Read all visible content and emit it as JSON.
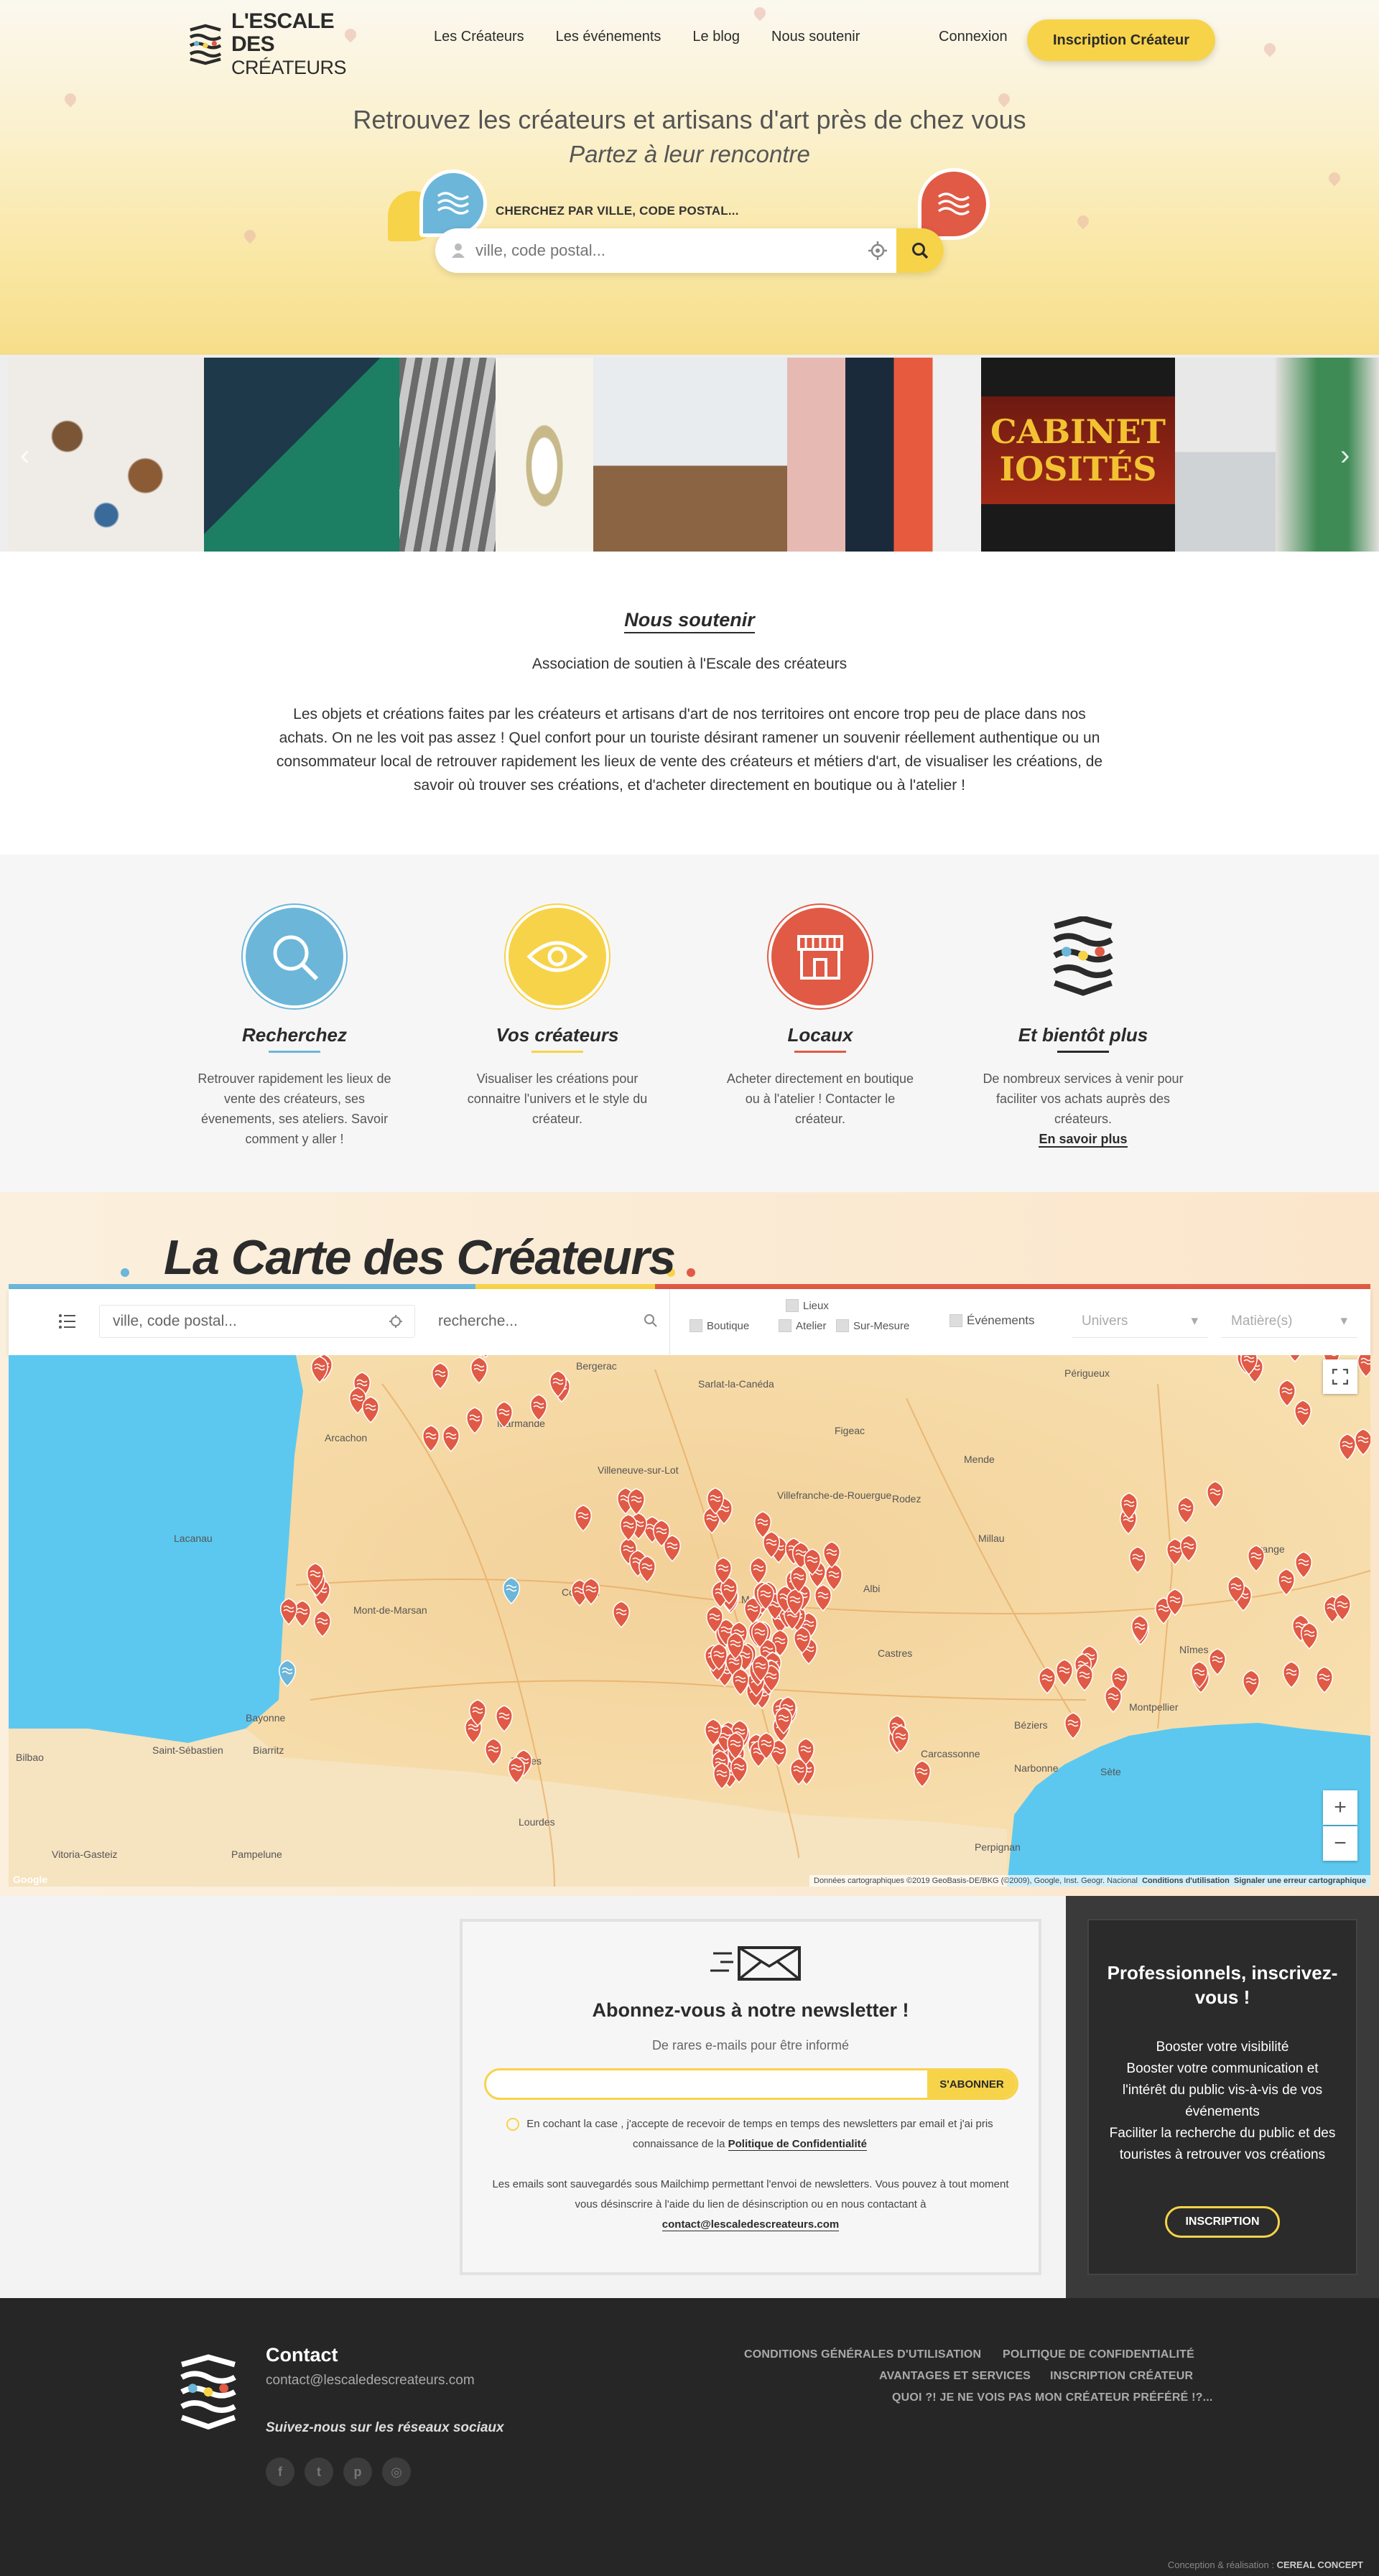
{
  "header": {
    "logo_line1": "L'ESCALE DES",
    "logo_line2": "CRÉATEURS",
    "nav": [
      "Les Créateurs",
      "Les événements",
      "Le blog",
      "Nous soutenir"
    ],
    "login": "Connexion",
    "signup": "Inscription Créateur"
  },
  "hero": {
    "title": "Retrouvez les créateurs et artisans d'art près de chez vous",
    "subtitle": "Partez à leur rencontre",
    "search_label": "CHERCHEZ PAR VILLE, CODE POSTAL...",
    "search_placeholder": "ville, code postal...",
    "photo_slide_text_1": "CABINET",
    "photo_slide_text_2": "IOSITÉS"
  },
  "soutenir": {
    "title": "Nous soutenir",
    "subtitle": "Association de soutien à l'Escale des créateurs",
    "text": "Les objets et créations faites par les créateurs et artisans d'art de nos territoires ont encore trop peu de place dans nos achats. On ne les voit pas assez ! Quel confort pour un touriste désirant ramener un souvenir réellement authentique ou un consommateur local de retrouver rapidement les lieux de vente des créateurs et métiers d'art, de visualiser les créations, de savoir où trouver ses créations, et d'acheter directement en boutique ou à l'atelier !"
  },
  "features": [
    {
      "title": "Recherchez",
      "text": "Retrouver rapidement les lieux de vente des créateurs, ses évenements, ses ateliers. Savoir comment y aller !",
      "color": "#6cb6d9"
    },
    {
      "title": "Vos créateurs",
      "text": "Visualiser les créations pour connaitre l'univers et le style du créateur.",
      "color": "#f7d34a"
    },
    {
      "title": "Locaux",
      "text": "Acheter directement en boutique ou à l'atelier ! Contacter le créateur.",
      "color": "#e05a45"
    },
    {
      "title": "Et bientôt plus",
      "text": "De nombreux services à venir pour faciliter vos achats auprès des créateurs.",
      "link": "En savoir plus",
      "color": "#2b2b2b"
    }
  ],
  "map": {
    "title": "La Carte des Créateurs",
    "city_placeholder": "ville, code postal...",
    "search_placeholder": "recherche...",
    "lieux": "Lieux",
    "boutique": "Boutique",
    "atelier": "Atelier",
    "sur_mesure": "Sur-Mesure",
    "evenements": "Événements",
    "univers": "Univers",
    "matieres": "Matière(s)",
    "places": [
      "Bergerac",
      "Sarlat-la-Canéda",
      "Arcachon",
      "Marmande",
      "Figeac",
      "Villeneuve-sur-Lot",
      "Villefranche-de-Rouergue",
      "Rodez",
      "Mont-de-Marsan",
      "Condom",
      "Montauban",
      "Albi",
      "Castres",
      "Bayonne",
      "Biarritz",
      "Tarbes",
      "Lourdes",
      "Carcassonne",
      "Narbonne",
      "Béziers",
      "Sète",
      "Montpellier",
      "Nîmes",
      "Mende",
      "Orange",
      "Pampelune",
      "Vitoria-Gasteiz",
      "Bilbao",
      "Saint-Sébastien",
      "Perpignan",
      "Millau",
      "Lacanau",
      "Périgueux"
    ],
    "attribution": "Données cartographiques ©2019 GeoBasis-DE/BKG (©2009), Google, Inst. Geogr. Nacional",
    "terms": "Conditions d'utilisation",
    "report": "Signaler une erreur cartographique",
    "google": "Google"
  },
  "newsletter": {
    "title": "Abonnez-vous à notre newsletter !",
    "subtitle": "De rares e-mails pour être informé",
    "button": "S'ABONNER",
    "consent": "En cochant la case , j'accepte de recevoir de temps en temps des newsletters par email et j'ai pris connaissance de la",
    "privacy": "Politique de Confidentialité",
    "legal": "Les emails sont sauvegardés sous Mailchimp permettant l'envoi de newsletters. Vous pouvez à tout moment vous désinscrire à l'aide du lien de désinscription ou en nous contactant à",
    "email": "contact@lescaledescreateurs.com"
  },
  "pro": {
    "title": "Professionnels, inscrivez-vous !",
    "text": "Booster votre visibilité\nBooster votre communication et l'intérêt du public vis-à-vis de vos événements\nFaciliter la recherche du public et des touristes à retrouver vos créations",
    "button": "INSCRIPTION"
  },
  "footer": {
    "contact": "Contact",
    "email": "contact@lescaledescreateurs.com",
    "follow": "Suivez-nous sur les réseaux sociaux",
    "links": [
      "CONDITIONS GÉNÉRALES D'UTILISATION",
      "POLITIQUE DE CONFIDENTIALITÉ",
      "AVANTAGES ET SERVICES",
      "INSCRIPTION CRÉATEUR",
      "QUOI ?! JE NE VOIS PAS MON CRÉATEUR PRÉFÉRÉ !?..."
    ],
    "credit_prefix": "Conception & réalisation :",
    "credit_name": "CEREAL CONCEPT"
  },
  "colors": {
    "yellow": "#f7d34a",
    "blue": "#6cb6d9",
    "red": "#e05a45",
    "dark": "#2b2b2b"
  }
}
